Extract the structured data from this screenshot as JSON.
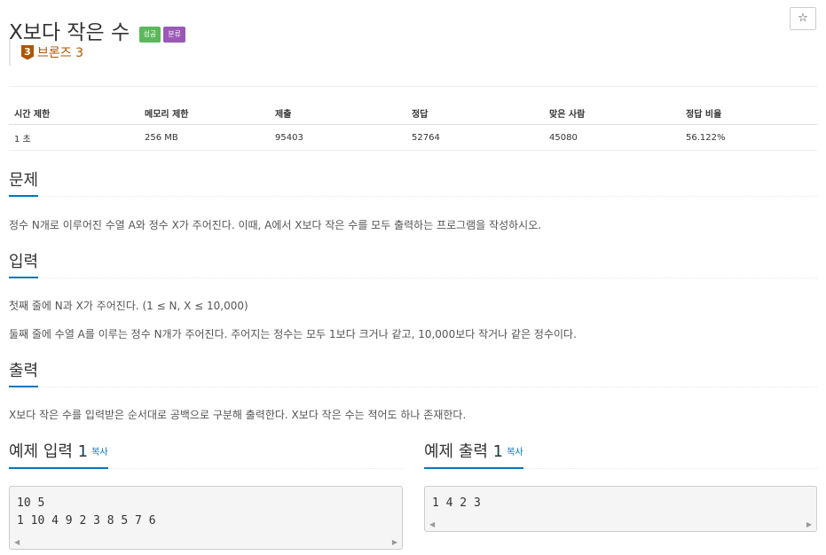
{
  "problem": {
    "title": "X보다 작은 수",
    "badges": [
      "성공",
      "분류"
    ],
    "star_icon": "☆",
    "tier": {
      "number": "3",
      "label": "브론즈 3",
      "color": "#ad5600"
    }
  },
  "stats": {
    "headers": [
      "시간 제한",
      "메모리 제한",
      "제출",
      "정답",
      "맞은 사람",
      "정답 비율"
    ],
    "values": [
      "1 초",
      "256 MB",
      "95403",
      "52764",
      "45080",
      "56.122%"
    ]
  },
  "sections": {
    "problem": {
      "heading": "문제",
      "text": "정수 N개로 이루어진 수열 A와 정수 X가 주어진다. 이때, A에서 X보다 작은 수를 모두 출력하는 프로그램을 작성하시오."
    },
    "input": {
      "heading": "입력",
      "lines": [
        "첫째 줄에 N과 X가 주어진다. (1 ≤ N, X ≤ 10,000)",
        "둘째 줄에 수열 A를 이루는 정수 N개가 주어진다. 주어지는 정수는 모두 1보다 크거나 같고, 10,000보다 작거나 같은 정수이다."
      ]
    },
    "output": {
      "heading": "출력",
      "text": "X보다 작은 수를 입력받은 순서대로 공백으로 구분해 출력한다. X보다 작은 수는 적어도 하나 존재한다."
    }
  },
  "samples": {
    "input": {
      "title": "예제 입력 1",
      "copy": "복사",
      "content": "10 5\n1 10 4 9 2 3 8 5 7 6"
    },
    "output": {
      "title": "예제 출력 1",
      "copy": "복사",
      "content": "1 4 2 3"
    }
  },
  "colors": {
    "accent": "#0076c0",
    "success": "#5cb85c",
    "category": "#9b59b6"
  }
}
